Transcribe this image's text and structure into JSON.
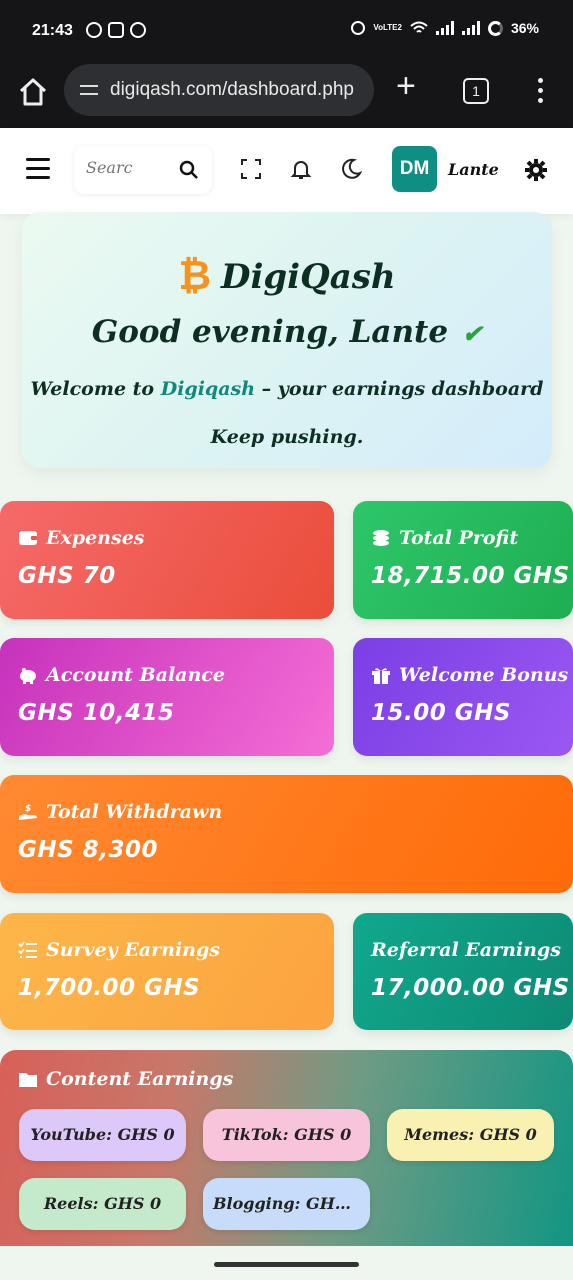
{
  "statusbar": {
    "time": "21:43",
    "battery": "36%",
    "network": "VoLTE2"
  },
  "browser": {
    "url": "digiqash.com/dashboard.php",
    "tab_count": "1"
  },
  "header": {
    "search_placeholder": "Searc",
    "avatar_initials": "DM",
    "username": "Lante",
    "icons": [
      "menu-icon",
      "search-icon",
      "fullscreen-icon",
      "bell-icon",
      "moon-icon",
      "gear-icon"
    ]
  },
  "welcome": {
    "brand_symbol": "₿",
    "brand": "DigiQash",
    "greeting": "Good evening, Lante",
    "check": "✔",
    "line_prefix": "Welcome to",
    "line_highlight": "Digiqash",
    "line_suffix": "– your earnings dashboard",
    "subline": "Keep pushing."
  },
  "stats": {
    "expenses": {
      "label": "Expenses",
      "value": "GHS 70"
    },
    "total_profit": {
      "label": "Total Profit",
      "value": "18,715.00 GHS"
    },
    "account_balance": {
      "label": "Account Balance",
      "value": "GHS 10,415"
    },
    "welcome_bonus": {
      "label": "Welcome Bonus",
      "value": "15.00 GHS"
    },
    "total_withdrawn": {
      "label": "Total Withdrawn",
      "value": "GHS 8,300"
    },
    "survey_earnings": {
      "label": "Survey Earnings",
      "value": "1,700.00 GHS"
    },
    "referral_earnings": {
      "label": "Referral Earnings",
      "value": "17,000.00 GHS"
    }
  },
  "content_earnings": {
    "label": "Content Earnings",
    "items": [
      "YouTube: GHS 0",
      "TikTok: GHS 0",
      "Memes: GHS 0",
      "Reels: GHS 0",
      "Blogging: GHS..."
    ]
  },
  "colors": {
    "brand_accent": "#108a7b",
    "bitcoin": "#f7931a",
    "expenses": "#ea4d3a",
    "profit": "#1fae52",
    "balance": "#e052cb",
    "bonus": "#8a4bea",
    "withdrawn": "#ff7518",
    "survey": "#fca33f",
    "referral": "#0d8a74"
  }
}
